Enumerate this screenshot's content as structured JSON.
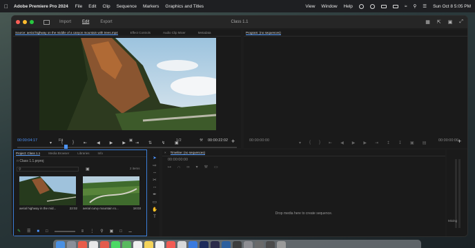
{
  "menubar": {
    "app_name": "Adobe Premiere Pro 2024",
    "items": [
      "File",
      "Edit",
      "Clip",
      "Sequence",
      "Markers",
      "Graphics and Titles"
    ],
    "right_items": [
      "View",
      "Window",
      "Help"
    ],
    "clock": "Sun Oct 8  5:05 PM"
  },
  "window": {
    "title": "Class 1.1",
    "tabs": [
      "Import",
      "Edit",
      "Export"
    ]
  },
  "source": {
    "tabs": [
      "Source: aerial highway on the middle of a canyon mountain with trees.mp4",
      "Effect Controls",
      "Audio Clip Mixer",
      "Metadata"
    ],
    "timecode_in": "00:00:04:17",
    "fit": "Fit",
    "fraction": "1/2",
    "timecode_out": "00:00:22:02"
  },
  "program": {
    "tab": "Program: (no sequences)",
    "timecode_left": "00:00:00:00",
    "timecode_right": "00:00:00:00"
  },
  "project": {
    "tabs": [
      "Project: Class 1.1",
      "Media Browser",
      "Libraries",
      "Info"
    ],
    "folder": "Class 1.1.prproj",
    "items_count": "2 items",
    "clips": [
      {
        "name": "aerial highway in the mid...",
        "duration": "22:02"
      },
      {
        "name": "aerial curvy mountain ro...",
        "duration": "18:03"
      }
    ]
  },
  "timeline": {
    "tab": "Timeline: (no sequences)",
    "timecode": "00:00:00:00",
    "empty_message": "Drop media here to create sequence."
  },
  "meters": {
    "label": "Mixing"
  },
  "colors": {
    "accent": "#4d95ff",
    "panel_bg": "#1a1a1a"
  }
}
